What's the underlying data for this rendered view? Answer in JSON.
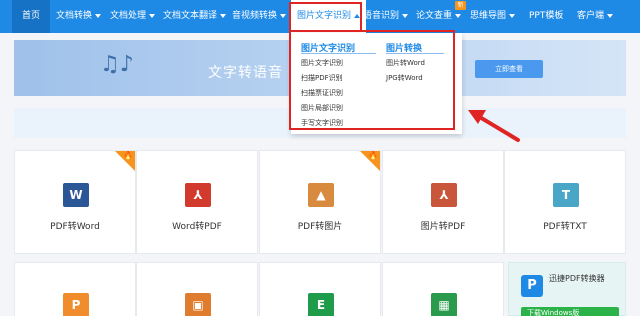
{
  "nav": {
    "home": "首页",
    "items": [
      {
        "label": "文档转换"
      },
      {
        "label": "文档处理"
      },
      {
        "label": "文档文本翻译"
      },
      {
        "label": "音视频转换"
      },
      {
        "label": "图片文字识别"
      },
      {
        "label": "语音识别"
      },
      {
        "label": "论文查重"
      },
      {
        "label": "思维导图"
      },
      {
        "label": "PPT模板"
      },
      {
        "label": "客户端"
      }
    ],
    "new_badge": "新"
  },
  "banner": {
    "title": "文字转语音",
    "button": "立即查看"
  },
  "dropdown": {
    "col1": {
      "heading": "图片文字识别",
      "items": [
        "图片文字识别",
        "扫描PDF识别",
        "扫描票证识别",
        "图片局部识别",
        "手写文字识别"
      ]
    },
    "col2": {
      "heading": "图片转换",
      "items": [
        "图片转Word",
        "JPG转Word"
      ]
    }
  },
  "tools": {
    "row1": [
      {
        "label": "PDF转Word",
        "icon_letter": "W",
        "icon": "word-icon",
        "color": "#2b5797",
        "hot": true
      },
      {
        "label": "Word转PDF",
        "icon_letter": "⅄",
        "icon": "pdf-icon",
        "color": "#d13a2c",
        "hot": false
      },
      {
        "label": "PDF转图片",
        "icon_letter": "▲",
        "icon": "image-icon",
        "color": "#d88a3e",
        "hot": true
      },
      {
        "label": "图片转PDF",
        "icon_letter": "⅄",
        "icon": "pdf-icon",
        "color": "#c9563b",
        "hot": false
      },
      {
        "label": "PDF转TXT",
        "icon_letter": "T",
        "icon": "txt-icon",
        "color": "#49a6c6",
        "hot": false
      }
    ],
    "row2": [
      {
        "icon_letter": "P",
        "icon": "ppt-icon",
        "color": "#f08c2c"
      },
      {
        "icon_letter": "▣",
        "icon": "slides-icon",
        "color": "#e07c2e"
      },
      {
        "icon_letter": "E",
        "icon": "excel-icon",
        "color": "#1f9c4a"
      },
      {
        "icon_letter": "▦",
        "icon": "sheet-icon",
        "color": "#2a9a4c"
      }
    ],
    "promo": {
      "logo": "P",
      "text": "迅捷PDF转换器",
      "button": "下载Windows版"
    }
  },
  "colors": {
    "nav": "#1e8ae6",
    "highlight": "#e02424",
    "hot": "#f7941d"
  }
}
